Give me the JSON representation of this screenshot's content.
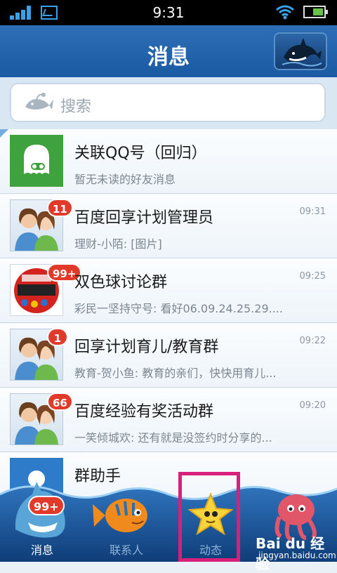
{
  "status_bar": {
    "time": "9:31"
  },
  "header": {
    "title": "消息"
  },
  "search": {
    "placeholder": "搜索"
  },
  "conversations": [
    {
      "name": "关联QQ号（回归）",
      "preview": "暂无未读的好友消息",
      "time": "",
      "badge": "",
      "avatar": "qq-ghost"
    },
    {
      "name": "百度回享计划管理员",
      "preview": "理财-小陌: [图片]",
      "time": "09:31",
      "badge": "11",
      "avatar": "people"
    },
    {
      "name": "双色球讨论群",
      "preview": "彩民一坚持守号: 看好06.09.24.25.29....",
      "time": "09:25",
      "badge": "99+",
      "avatar": "lottery"
    },
    {
      "name": "回享计划育儿/教育群",
      "preview": "教育-贺小鱼: 教育的亲们，快快用育儿...",
      "time": "09:22",
      "badge": "1",
      "avatar": "people"
    },
    {
      "name": "百度经验有奖活动群",
      "preview": "一笑倾城欢: 还有就是没签约时分享的...",
      "time": "09:20",
      "badge": "66",
      "avatar": "people"
    },
    {
      "name": "群助手",
      "preview": "",
      "time": "",
      "badge": "",
      "avatar": "group-helper"
    }
  ],
  "tabs": [
    {
      "label": "消息",
      "badge": "99+",
      "icon": "shark-icon",
      "active": true
    },
    {
      "label": "联系人",
      "badge": "",
      "icon": "fish-icon",
      "active": false
    },
    {
      "label": "动态",
      "badge": "",
      "icon": "starfish-icon",
      "active": false
    },
    {
      "label": "",
      "badge": "",
      "icon": "octopus-icon",
      "active": false
    }
  ],
  "watermark": {
    "brand": "Bai du 经验",
    "url": "jingyan.baidu.com"
  }
}
